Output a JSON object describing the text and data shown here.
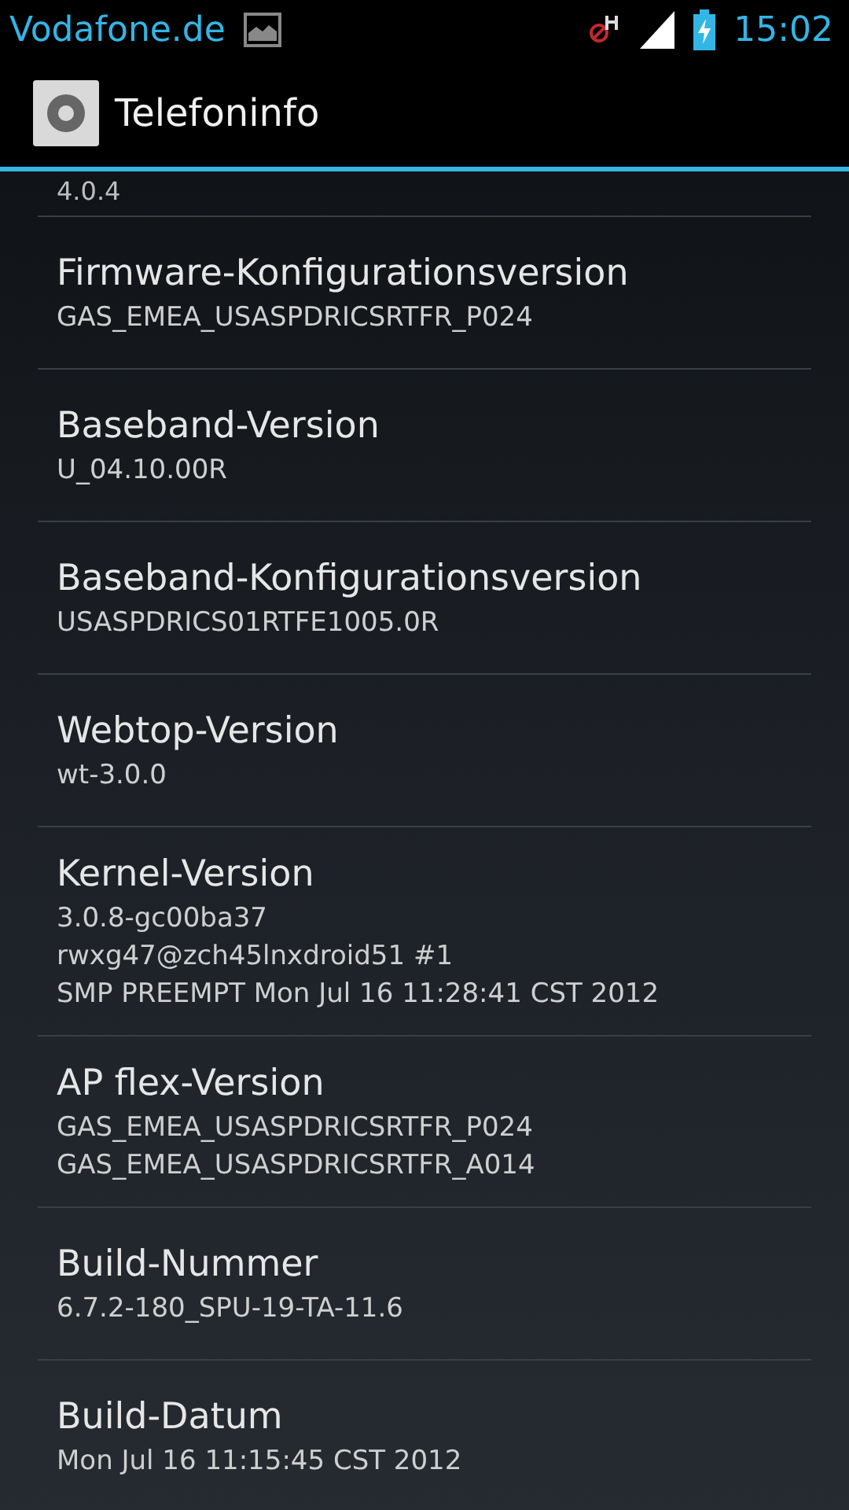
{
  "status_bar": {
    "carrier": "Vodafone.de",
    "time": "15:02"
  },
  "action_bar": {
    "title": "Telefoninfo"
  },
  "list": {
    "clipped_summary": "4.0.4",
    "items": [
      {
        "title": "Firmware-Konfigurationsversion",
        "lines": [
          "GAS_EMEA_USASPDRICSRTFR_P024"
        ]
      },
      {
        "title": "Baseband-Version",
        "lines": [
          "U_04.10.00R"
        ]
      },
      {
        "title": "Baseband-Konfigurationsversion",
        "lines": [
          "USASPDRICS01RTFE1005.0R"
        ]
      },
      {
        "title": "Webtop-Version",
        "lines": [
          "wt-3.0.0"
        ]
      },
      {
        "title": "Kernel-Version",
        "lines": [
          "3.0.8-gc00ba37",
          "rwxg47@zch45lnxdroid51 #1",
          "SMP PREEMPT Mon Jul 16 11:28:41 CST 2012"
        ]
      },
      {
        "title": "AP flex-Version",
        "lines": [
          "GAS_EMEA_USASPDRICSRTFR_P024",
          "GAS_EMEA_USASPDRICSRTFR_A014"
        ]
      },
      {
        "title": "Build-Nummer",
        "lines": [
          "6.7.2-180_SPU-19-TA-11.6"
        ]
      },
      {
        "title": "Build-Datum",
        "lines": [
          "Mon Jul 16 11:15:45 CST 2012"
        ]
      }
    ]
  }
}
